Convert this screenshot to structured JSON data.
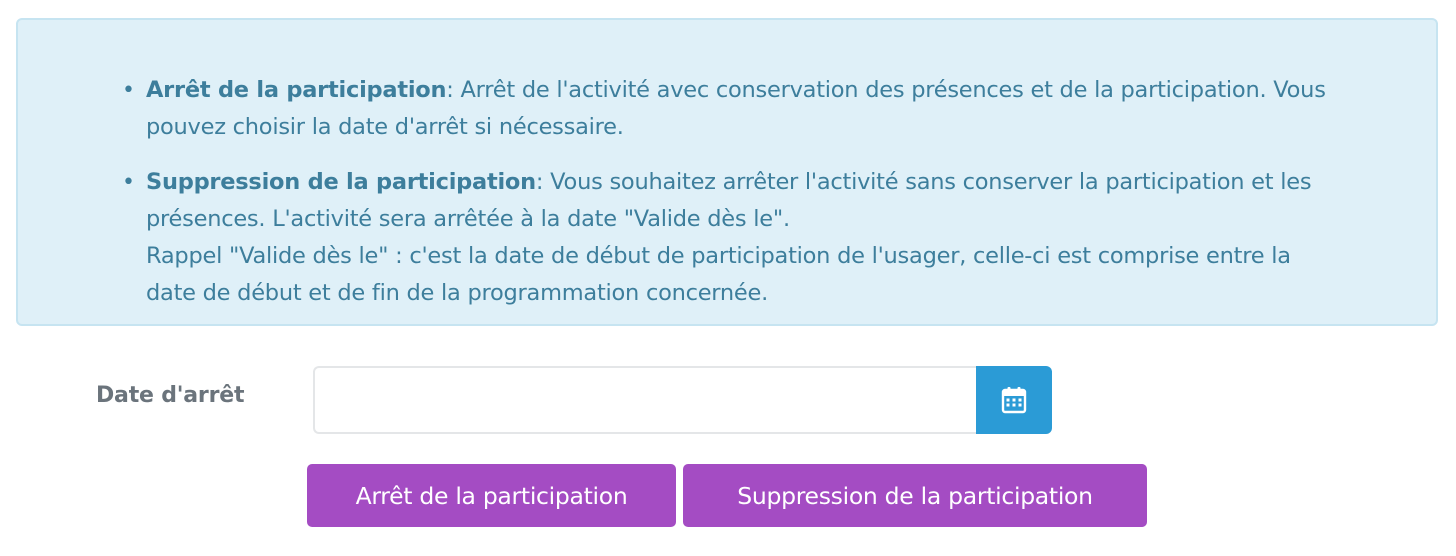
{
  "info": {
    "items": [
      {
        "title": "Arrêt de la participation",
        "lines": [
          ": Arrêt de l'activité avec conservation des présences et de la participation. Vous",
          "pouvez choisir la date d'arrêt si nécessaire."
        ]
      },
      {
        "title": "Suppression de la participation",
        "lines": [
          ": Vous souhaitez arrêter l'activité sans conserver la participation et les",
          "présences. L'activité sera arrêtée à la date \"Valide dès le\".",
          "Rappel \"Valide dès le\" : c'est la date de début de participation de l'usager, celle-ci est comprise entre la",
          "date de début et de fin de la programmation concernée."
        ]
      }
    ]
  },
  "form": {
    "date_label": "Date d'arrêt",
    "date_value": "",
    "calendar_icon": "calendar-icon"
  },
  "actions": {
    "stop_label": "Arrêt de la participation",
    "delete_label": "Suppression de la participation"
  },
  "colors": {
    "info_bg": "#dff0f8",
    "info_text": "#3d7e9c",
    "calendar_button": "#2b9bd6",
    "action_button": "#a44cc3"
  }
}
